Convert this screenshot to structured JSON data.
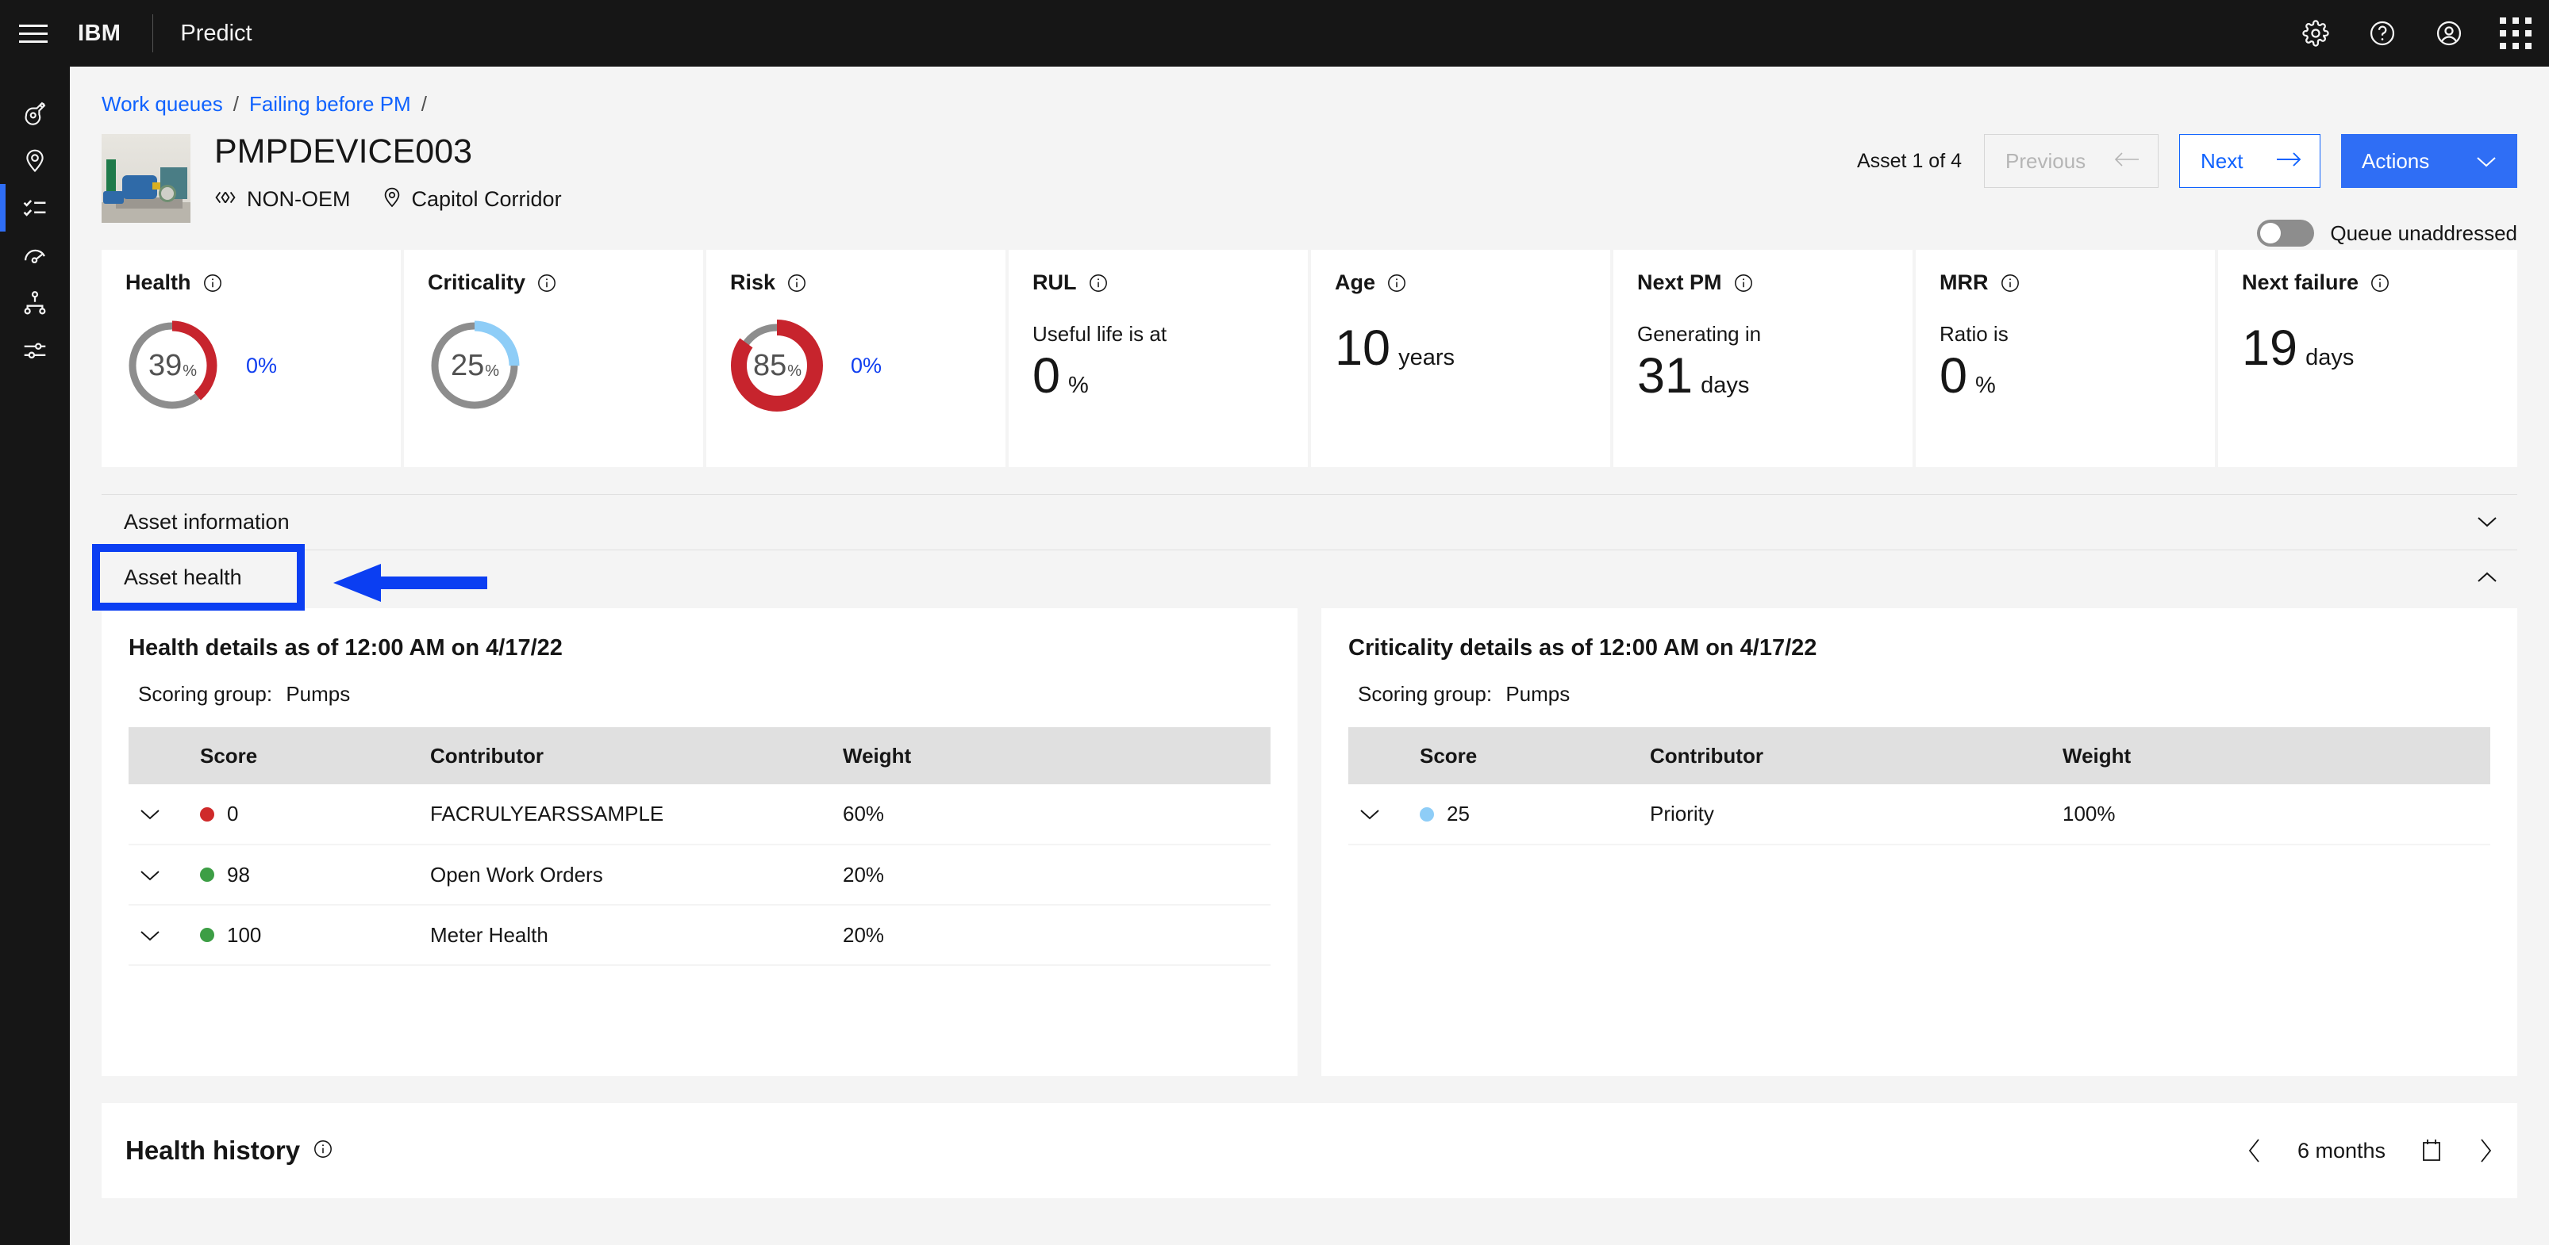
{
  "header": {
    "menu_icon": "hamburger-icon",
    "brand": "IBM",
    "product": "Predict",
    "icons": [
      "gear-icon",
      "help-icon",
      "user-avatar-icon",
      "app-switcher-icon"
    ]
  },
  "sidebar": {
    "items": [
      {
        "icon": "asset-icon",
        "active": false
      },
      {
        "icon": "location-pin-icon",
        "active": false
      },
      {
        "icon": "work-queue-checklist-icon",
        "active": true
      },
      {
        "icon": "gauge-meter-icon",
        "active": false
      },
      {
        "icon": "hierarchy-icon",
        "active": false
      },
      {
        "icon": "settings-sliders-icon",
        "active": false
      }
    ]
  },
  "breadcrumb": {
    "items": [
      "Work queues",
      "Failing before PM"
    ],
    "separator": "/"
  },
  "asset": {
    "title": "PMPDEVICE003",
    "oem_label": "NON-OEM",
    "oem_icon": "code-brackets-icon",
    "location_label": "Capitol Corridor",
    "location_icon": "location-pin-icon",
    "thumbnail_alt": "industrial-pump-photo"
  },
  "nav": {
    "count_label": "Asset 1 of 4",
    "previous_label": "Previous",
    "previous_disabled": true,
    "next_label": "Next",
    "actions_label": "Actions",
    "queue_toggle_label": "Queue unaddressed",
    "queue_toggle_on": false
  },
  "kpis": [
    {
      "title": "Health",
      "type": "donut",
      "value": 39,
      "suffix": "%",
      "arc_color": "#c7242d",
      "track_color": "#8d8d8d",
      "delta": "0%",
      "delta_color": "#0f3ef0"
    },
    {
      "title": "Criticality",
      "type": "donut",
      "value": 25,
      "suffix": "%",
      "arc_color": "#8ecdf7",
      "track_color": "#8d8d8d",
      "delta": "",
      "delta_color": "#0f3ef0"
    },
    {
      "title": "Risk",
      "type": "donut",
      "value": 85,
      "suffix": "%",
      "arc_color": "#c7242d",
      "track_color": "#8d8d8d",
      "delta": "0%",
      "delta_color": "#0f3ef0",
      "thick": true
    },
    {
      "title": "RUL",
      "type": "text",
      "caption": "Useful life is at",
      "number": "0",
      "unit": "%"
    },
    {
      "title": "Age",
      "type": "text",
      "caption": "",
      "number": "10",
      "unit": "years"
    },
    {
      "title": "Next PM",
      "type": "text",
      "caption": "Generating in",
      "number": "31",
      "unit": "days"
    },
    {
      "title": "MRR",
      "type": "text",
      "caption": "Ratio is",
      "number": "0",
      "unit": "%"
    },
    {
      "title": "Next failure",
      "type": "text",
      "caption": "",
      "number": "19",
      "unit": "days"
    }
  ],
  "accordions": {
    "asset_information": {
      "label": "Asset information",
      "expanded": false,
      "chevron": "chevron-down-icon"
    },
    "asset_health": {
      "label": "Asset health",
      "expanded": true,
      "chevron": "chevron-up-icon",
      "highlighted": true
    }
  },
  "health_panel": {
    "title": "Health details as of 12:00 AM on 4/17/22",
    "scoring_group_label": "Scoring group:",
    "scoring_group_value": "Pumps",
    "columns": [
      "Score",
      "Contributor",
      "Weight"
    ],
    "rows": [
      {
        "score": "0",
        "dot_color": "#cf2a2a",
        "contributor": "FACRULYEARSSAMPLE",
        "weight": "60%"
      },
      {
        "score": "98",
        "dot_color": "#3d9e45",
        "contributor": "Open Work Orders",
        "weight": "20%"
      },
      {
        "score": "100",
        "dot_color": "#3d9e45",
        "contributor": "Meter Health",
        "weight": "20%"
      }
    ]
  },
  "criticality_panel": {
    "title": "Criticality details as of 12:00 AM on 4/17/22",
    "scoring_group_label": "Scoring group:",
    "scoring_group_value": "Pumps",
    "columns": [
      "Score",
      "Contributor",
      "Weight"
    ],
    "rows": [
      {
        "score": "25",
        "dot_color": "#8ecdf7",
        "contributor": "Priority",
        "weight": "100%"
      }
    ]
  },
  "health_history": {
    "title": "Health history",
    "range_label": "6 months",
    "prev_icon": "chevron-left-icon",
    "next_icon": "chevron-right-icon",
    "calendar_icon": "calendar-icon"
  },
  "annotation": {
    "color": "#0b3ef2",
    "target": "asset-health-accordion-header"
  }
}
